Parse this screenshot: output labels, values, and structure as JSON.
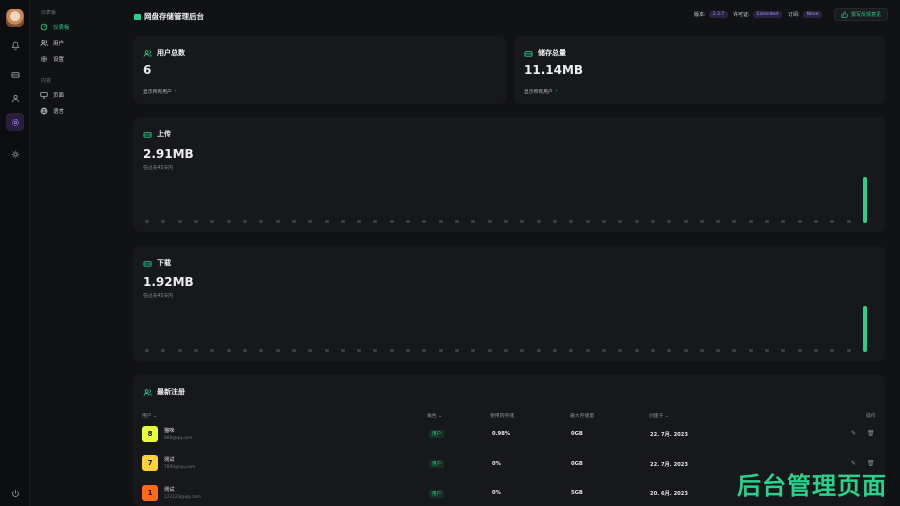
{
  "sidebar": {
    "section1": "仪表板",
    "items1": [
      {
        "label": "仪表板"
      },
      {
        "label": "用户"
      },
      {
        "label": "设置"
      }
    ],
    "section2": "内容",
    "items2": [
      {
        "label": "页面"
      },
      {
        "label": "语言"
      }
    ]
  },
  "header": {
    "title": "网盘存储管理后台",
    "version_label": "版本:",
    "version": "2.3.7",
    "license_label": "许可证:",
    "license": "Extended",
    "subscription_label": "订阅:",
    "subscription": "None",
    "write_review": "撰写反馈意见"
  },
  "cards": {
    "users": {
      "title": "用户总数",
      "value": "6",
      "link": "显示所有用户"
    },
    "storage": {
      "title": "储存总量",
      "value": "11.14MB",
      "link": "显示所有用户"
    },
    "upload": {
      "title": "上传",
      "value": "2.91MB",
      "sub": "在过去45天内"
    },
    "download": {
      "title": "下载",
      "value": "1.92MB",
      "sub": "在过去45天内"
    }
  },
  "chart_data": [
    {
      "type": "bar",
      "title": "上传",
      "points": 45,
      "note": "only last point visible",
      "last_value_fraction": 1.0
    },
    {
      "type": "bar",
      "title": "下载",
      "points": 45,
      "note": "only last point visible",
      "last_value_fraction": 1.0
    }
  ],
  "table": {
    "title": "最新注册",
    "headers": [
      "用户",
      "角色",
      "使用的存储",
      "最大存储量",
      "创建于",
      "操作"
    ],
    "rows": [
      {
        "badge": "8",
        "color": "#e9ff3a",
        "name": "猫咪",
        "email": "888@qq.com",
        "role": "用户",
        "used": "0.98%",
        "max": "0GB",
        "created": "22. 7月. 2023"
      },
      {
        "badge": "7",
        "color": "#ffd23a",
        "name": "测试",
        "email": "7890@qq.com",
        "role": "用户",
        "used": "0%",
        "max": "0GB",
        "created": "22. 7月. 2023"
      },
      {
        "badge": "1",
        "color": "#ff6a1a",
        "name": "测试",
        "email": "123123@qq.com",
        "role": "用户",
        "used": "0%",
        "max": "5GB",
        "created": "20. 6月. 2023"
      }
    ]
  },
  "watermark": "后台管理页面"
}
